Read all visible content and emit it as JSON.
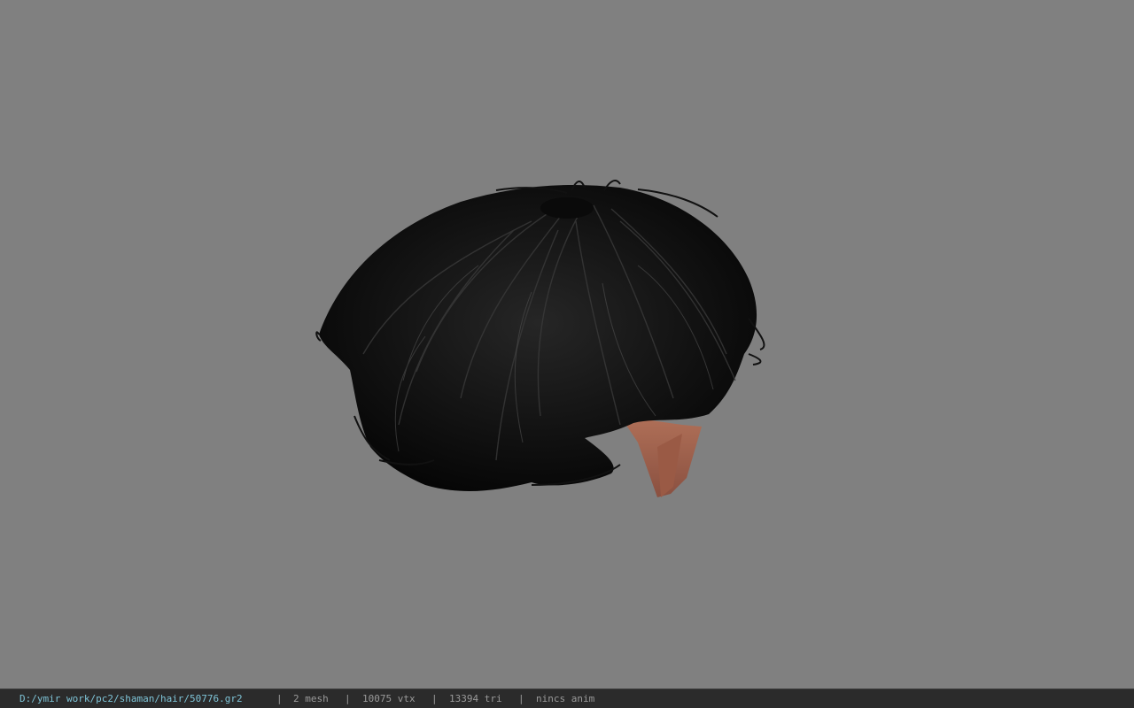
{
  "viewport": {
    "background_color": "#808080",
    "model": "hair mesh preview"
  },
  "statusbar": {
    "file_path": "D:/ymir work/pc2/shaman/hair/50776.gr2",
    "separator": "|",
    "mesh_count": "2 mesh",
    "vertex_count": "10075 vtx",
    "triangle_count": "13394 tri",
    "anim_status": "nincs anim",
    "path_color": "#7ec3d6",
    "text_color": "#9a9a9a"
  }
}
